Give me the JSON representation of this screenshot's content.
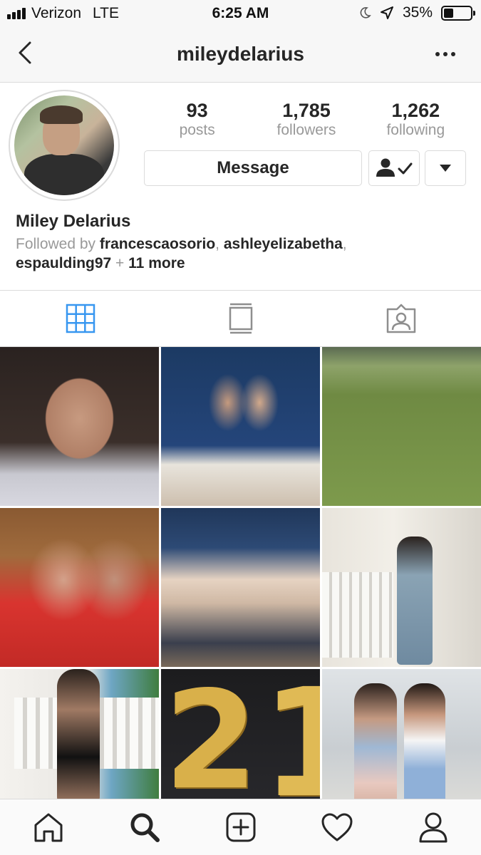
{
  "status_bar": {
    "carrier": "Verizon",
    "network": "LTE",
    "time": "6:25 AM",
    "battery_percent": "35%",
    "battery_level": 0.35
  },
  "header": {
    "username": "mileydelarius"
  },
  "profile": {
    "stats": [
      {
        "value": "93",
        "label": "posts"
      },
      {
        "value": "1,785",
        "label": "followers"
      },
      {
        "value": "1,262",
        "label": "following"
      }
    ],
    "message_label": "Message",
    "full_name": "Miley Delarius",
    "followed_by": {
      "prefix": "Followed by",
      "user1": "francescaosorio",
      "sep1": ",",
      "user2": "ashleyelizabetha",
      "sep2": ",",
      "user3": "espaulding97",
      "plus": "+",
      "more": "11 more"
    }
  },
  "tabs": [
    {
      "icon": "grid-icon",
      "active": true
    },
    {
      "icon": "feed-list-icon",
      "active": false
    },
    {
      "icon": "tagged-icon",
      "active": false
    }
  ],
  "bottom_nav": [
    {
      "icon": "home-icon"
    },
    {
      "icon": "search-icon",
      "active": true
    },
    {
      "icon": "add-post-icon"
    },
    {
      "icon": "heart-icon"
    },
    {
      "icon": "profile-icon"
    }
  ],
  "colors": {
    "active_tab": "#3897f0",
    "text_primary": "#262626",
    "text_secondary": "#999999",
    "border": "#dbdbdb"
  },
  "posts": {
    "post_8_balloons": [
      "2",
      "1"
    ]
  }
}
